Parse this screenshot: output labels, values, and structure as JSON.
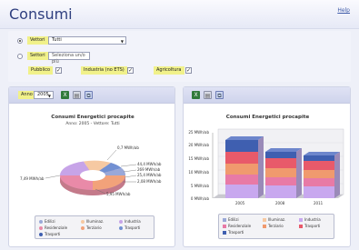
{
  "app": {
    "title": "Consumi",
    "help": "Help"
  },
  "filters": {
    "option1": {
      "label": "Vettori",
      "value": "Tutti",
      "selected": true
    },
    "option2": {
      "label": "Settori",
      "placeholder": "Seleziona un/o più",
      "selected": false
    },
    "sectors": [
      {
        "label": "Pubblico",
        "checked": true
      },
      {
        "label": "Industria (no ETS)",
        "checked": true
      },
      {
        "label": "Agricoltura",
        "checked": true
      }
    ]
  },
  "left_panel": {
    "year_label": "Anno",
    "year_value": "2005",
    "chart_title": "Consumi Energetici procapite",
    "chart_subtitle": "Anno: 2005 - Vettore: Tutti",
    "callouts": [
      "0,7 MWh/ab",
      "44,4 MWh/ab",
      "269 MWh/ab",
      "25,4 MWh/ab",
      "2,08 MWh/ab",
      "7,49 MWh/ab",
      "5,95 MWh/ab"
    ],
    "legend": [
      "Edilizi",
      "Illuminaz.",
      "Industria",
      "Residenziale",
      "Terziario",
      "Trasporti",
      "Trasporti"
    ]
  },
  "right_panel": {
    "chart_title": "Consumi Energetici procapite",
    "y_ticks": [
      "25 MWh/ab",
      "20 MWh/ab",
      "15 MWh/ab",
      "10 MWh/ab",
      "5 MWh/ab",
      "0 MWh/ab"
    ],
    "x_ticks": [
      "2005",
      "2008",
      "2011"
    ],
    "legend": [
      "Edilizi",
      "Illuminaz.",
      "Industria",
      "Residenziale",
      "Terziario",
      "Trasporti",
      "Trasporti"
    ]
  },
  "colors": {
    "accent": "#2f3f7f",
    "pie": [
      "#6e8fd0",
      "#f4a87a",
      "#e88aa8",
      "#c6a3e6",
      "#f0c36e",
      "#4f6fb0",
      "#d6d6d6"
    ],
    "stack": [
      "#c8a8ef",
      "#e87aa6",
      "#f09a6e",
      "#e85a6a",
      "#3f5fb0"
    ]
  }
}
